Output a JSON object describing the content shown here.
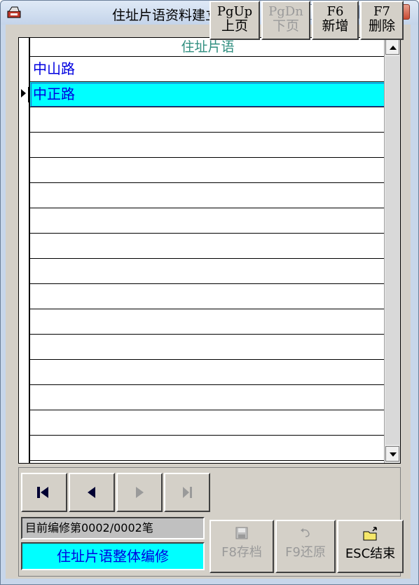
{
  "window": {
    "title": "住址片语资料建立"
  },
  "grid": {
    "column_header": "住址片语",
    "rows": [
      "中山路",
      "中正路",
      "",
      "",
      "",
      "",
      "",
      "",
      "",
      "",
      "",
      "",
      "",
      "",
      "",
      ""
    ],
    "selected_row": 1
  },
  "nav": {
    "first": "first-record-icon",
    "prev": "prev-record-icon",
    "next": "next-record-icon",
    "last": "last-record-icon"
  },
  "func": {
    "pgup_key": "PgUp",
    "pgup_label": "上页",
    "pgdn_key": "PgDn",
    "pgdn_label": "下页",
    "f6_key": "F6",
    "f6_label": "新增",
    "f7_key": "F7",
    "f7_label": "删除"
  },
  "status": {
    "record_text": "目前编修第0002/0002笔",
    "mode_text": "住址片语整体编修"
  },
  "actions": {
    "save_label": "F8存档",
    "restore_label": "F9还原",
    "exit_label": "ESC结束"
  },
  "colors": {
    "selection": "#00ffff",
    "text_blue": "#0000e0",
    "header_teal": "#2f8e7f",
    "face": "#d4d0c8"
  }
}
